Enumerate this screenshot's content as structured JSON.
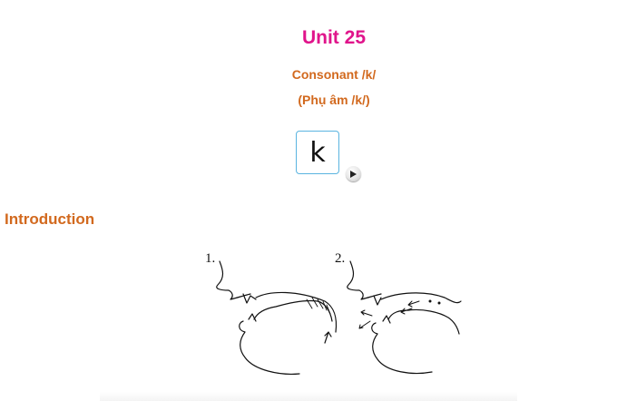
{
  "header": {
    "unit_title": "Unit 25",
    "subtitle_en": "Consonant /k/",
    "subtitle_vi": "(Phụ âm /k/)"
  },
  "phoneme": {
    "symbol": "k",
    "play_icon": "play-icon"
  },
  "introduction": {
    "heading": "Introduction",
    "figures": [
      {
        "label": "1."
      },
      {
        "label": "2."
      }
    ]
  },
  "colors": {
    "title": "#e0148b",
    "subtitle": "#d2691e",
    "card_border": "#5ab4e0"
  }
}
